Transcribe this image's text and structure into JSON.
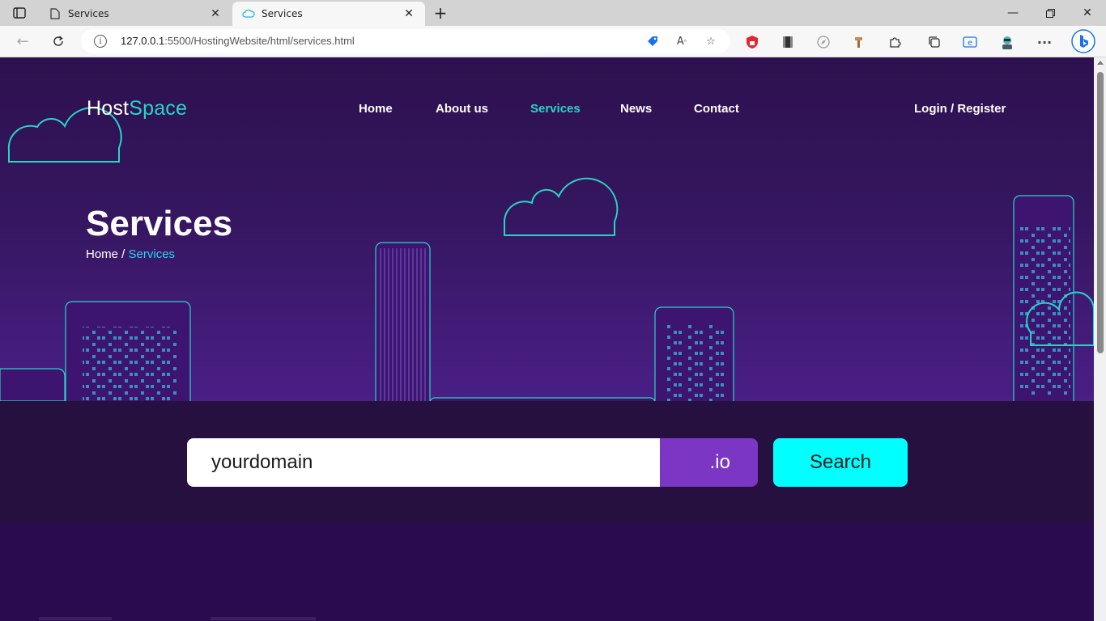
{
  "browser": {
    "tabs": [
      {
        "title": "Services",
        "active": false,
        "favicon": "page-icon"
      },
      {
        "title": "Services",
        "active": true,
        "favicon": "cloud-icon"
      }
    ],
    "url_host": "127.0.0.1",
    "url_rest": ":5500/HostingWebsite/html/services.html"
  },
  "site": {
    "logo_part1": "Host",
    "logo_part2": "Space",
    "nav": [
      {
        "label": "Home",
        "active": false
      },
      {
        "label": "About us",
        "active": false
      },
      {
        "label": "Services",
        "active": true
      },
      {
        "label": "News",
        "active": false
      },
      {
        "label": "Contact",
        "active": false
      }
    ],
    "auth_link": "Login / Register",
    "accent_color": "#27d5c8"
  },
  "hero": {
    "title": "Services",
    "breadcrumb_home": "Home",
    "breadcrumb_sep": " / ",
    "breadcrumb_current": "Services"
  },
  "domain_search": {
    "input_value": "yourdomain",
    "tld": ".io",
    "button_label": "Search"
  }
}
